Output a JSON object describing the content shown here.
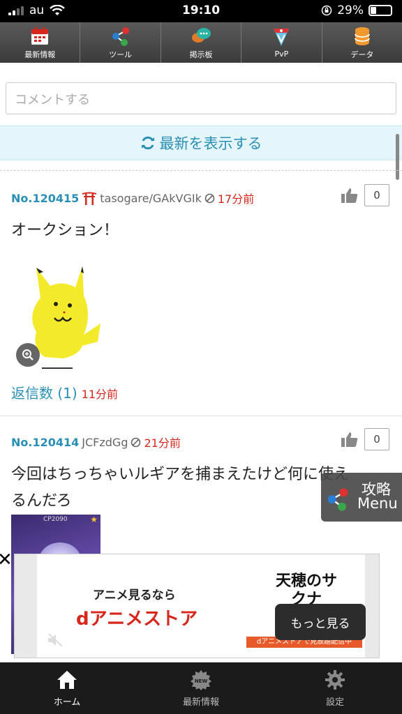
{
  "status_bar": {
    "carrier": "au",
    "time": "19:10",
    "battery": "29%"
  },
  "top_nav": [
    {
      "label": "最新情報",
      "icon": "calendar-icon"
    },
    {
      "label": "ツール",
      "icon": "share-icon"
    },
    {
      "label": "掲示板",
      "icon": "chat-bubbles-icon"
    },
    {
      "label": "PvP",
      "icon": "pvp-badge-icon"
    },
    {
      "label": "データ",
      "icon": "database-icon"
    }
  ],
  "comment": {
    "placeholder": "コメントする"
  },
  "refresh": {
    "label": "最新を表示する"
  },
  "posts": [
    {
      "no": "No.120415",
      "user": "tasogare/GAkVGIk",
      "time": "17分前",
      "likes": "0",
      "body": "オークション！",
      "replies_label": "返信数 (1)",
      "replies_time": "11分前"
    },
    {
      "no": "No.120414",
      "user": "JCFzdGg",
      "time": "21分前",
      "likes": "0",
      "body_line1": "今回はちっちゃいルギアを捕まえたけど何に使え",
      "body_line2": "るんだろ",
      "image_text": "CP2090"
    }
  ],
  "float_menu": {
    "line1": "攻略",
    "line2": "Menu"
  },
  "ad": {
    "close": "✕",
    "headline": "アニメ見るなら",
    "brand": "dアニメストア",
    "banner_logo": "天穂のサクナ",
    "banner_strip": "dアニメストアで見放題配信中",
    "more_button": "もっと見る"
  },
  "bottom_nav": [
    {
      "label": "ホーム",
      "icon": "home-icon",
      "active": true
    },
    {
      "label": "最新情報",
      "icon": "new-badge-icon",
      "active": false
    },
    {
      "label": "設定",
      "icon": "gear-icon",
      "active": false
    }
  ],
  "colors": {
    "accent": "#2a8fb5",
    "time_red": "#d9261c",
    "refresh_bg": "#e4f5fb"
  }
}
